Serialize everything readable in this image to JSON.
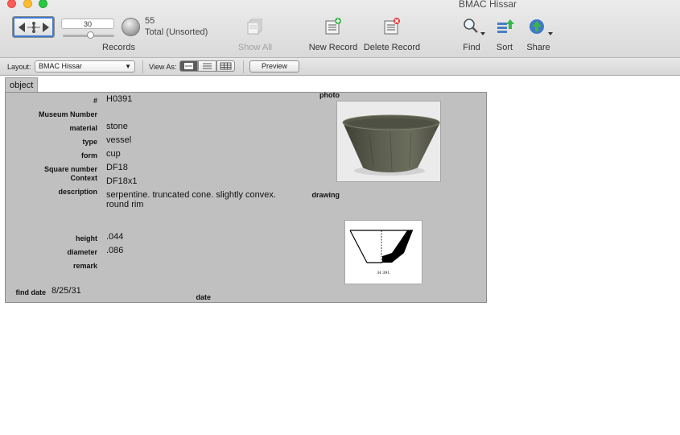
{
  "window": {
    "title": "BMAC Hissar"
  },
  "toolbar": {
    "record_number": "30",
    "found_count": "55",
    "total_label": "Total (Unsorted)",
    "records_label": "Records",
    "show_all_label": "Show All",
    "new_record_label": "New Record",
    "delete_record_label": "Delete Record",
    "find_label": "Find",
    "sort_label": "Sort",
    "share_label": "Share",
    "record_slider_fraction": 0.55
  },
  "layoutbar": {
    "layout_label": "Layout:",
    "layout_value": "BMAC Hissar",
    "view_as_label": "View As:",
    "preview_label": "Preview"
  },
  "tab": {
    "label": "object"
  },
  "record": {
    "number_label": "#",
    "number_value": "H0391",
    "museum_number_label": "Museum Number",
    "museum_number_value": "",
    "material_label": "material",
    "material_value": "stone",
    "type_label": "type",
    "type_value": "vessel",
    "form_label": "form",
    "form_value": "cup",
    "square_label": "Square number",
    "square_value": "DF18",
    "context_label": "Context",
    "context_value": "DF18x1",
    "description_label": "description",
    "description_value": "serpentine. truncated cone. slightly convex. round rim",
    "height_label": "height",
    "height_value": ".044",
    "diameter_label": "diameter",
    "diameter_value": ".086",
    "remark_label": "remark",
    "remark_value": "",
    "find_date_label": "find date",
    "find_date_value": "8/25/31",
    "date_label": "date",
    "photo_label": "photo",
    "drawing_label": "drawing",
    "drawing_caption": "H 391"
  },
  "colors": {
    "panel_bg": "#c0c0c0",
    "toolbar_bg": "#dedede",
    "close": "#fc5f57",
    "minimize": "#fdbc2e",
    "maximize": "#28c840",
    "selection_blue": "#3d7bd3"
  }
}
